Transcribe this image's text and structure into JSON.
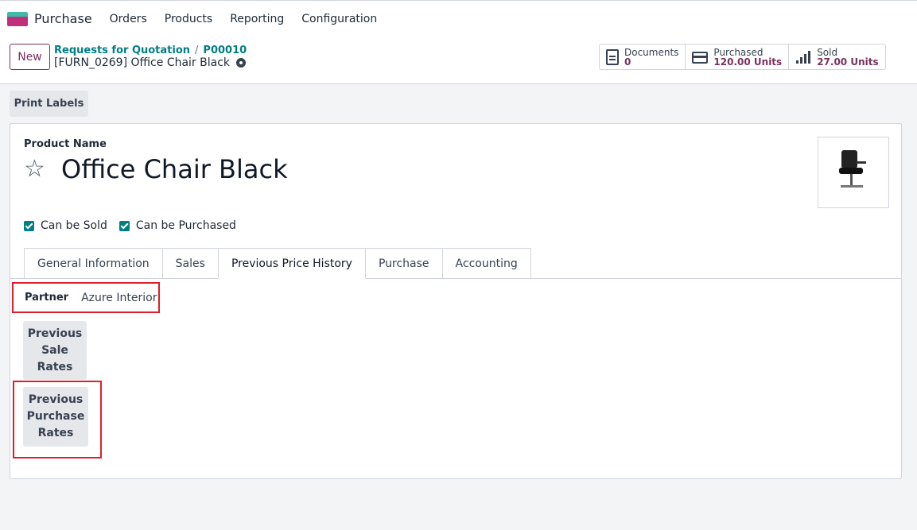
{
  "topbar": {
    "app_name": "Purchase",
    "menu": [
      "Orders",
      "Products",
      "Reporting",
      "Configuration"
    ]
  },
  "control": {
    "new_label": "New",
    "breadcrumb": [
      "Requests for Quotation",
      "P00010"
    ],
    "breadcrumb_sep": "/",
    "record_title": "[FURN_0269] Office Chair Black"
  },
  "smart_buttons": [
    {
      "label": "Documents",
      "value": "0",
      "icon": "document-icon"
    },
    {
      "label": "Purchased",
      "value": "120.00 Units",
      "icon": "credit-card-icon"
    },
    {
      "label": "Sold",
      "value": "27.00 Units",
      "icon": "signal-bars-icon"
    }
  ],
  "actions": {
    "print_labels": "Print Labels"
  },
  "product": {
    "name_label": "Product Name",
    "name": "Office Chair Black",
    "can_be_sold": "Can be Sold",
    "can_be_purchased": "Can be Purchased"
  },
  "tabs": [
    "General Information",
    "Sales",
    "Previous Price History",
    "Purchase",
    "Accounting"
  ],
  "active_tab": "Previous Price History",
  "price_history": {
    "partner_label": "Partner",
    "partner_value": "Azure Interior",
    "sale_rates": [
      "Previous",
      "Sale",
      "Rates"
    ],
    "purchase_rates": [
      "Previous",
      "Purchase",
      "Rates"
    ]
  },
  "colors": {
    "brand": "#7b3061",
    "link": "#017e84",
    "highlight": "#e11d2a"
  }
}
